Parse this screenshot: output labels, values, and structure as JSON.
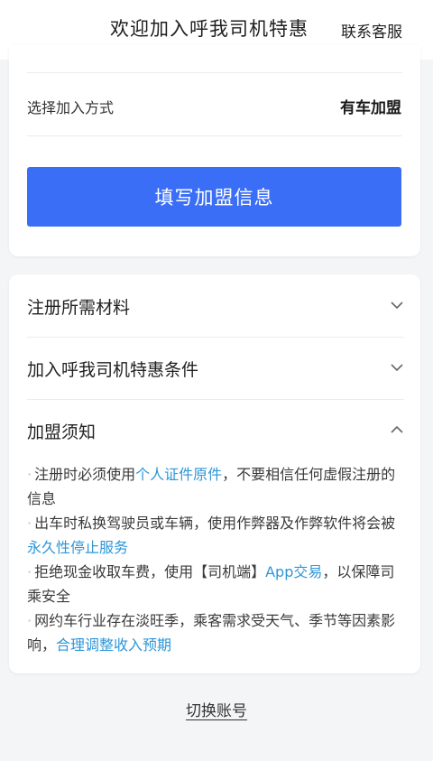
{
  "header": {
    "title": "欢迎加入呼我司机特惠",
    "service_label": "联系客服"
  },
  "join": {
    "method_label": "选择加入方式",
    "method_value": "有车加盟",
    "fill_button": "填写加盟信息"
  },
  "accordion": {
    "items": [
      {
        "label": "注册所需材料",
        "expanded": false,
        "icon": "chevron-down-icon"
      },
      {
        "label": "加入呼我司机特惠条件",
        "expanded": false,
        "icon": "chevron-down-icon"
      },
      {
        "label": "加盟须知",
        "expanded": true,
        "icon": "chevron-up-icon"
      }
    ],
    "notes": [
      {
        "bullet": "·",
        "pre": "注册时必须使用",
        "highlight": "个人证件原件",
        "post": "，不要相信任何虚假注册的信息"
      },
      {
        "bullet": "·",
        "pre": "出车时私换驾驶员或车辆，使用作弊器及作弊软件将会被",
        "highlight": "永久性停止服务",
        "post": ""
      },
      {
        "bullet": "·",
        "pre": "拒绝现金收取车费，使用【司机端】",
        "highlight": "App交易",
        "post": "，以保障司乘安全"
      },
      {
        "bullet": "·",
        "pre": "网约车行业存在淡旺季，乘客需求受天气、季节等因素影响，",
        "highlight": "合理调整收入预期",
        "post": ""
      }
    ]
  },
  "footer": {
    "switch_account": "切换账号"
  },
  "colors": {
    "primary_button": "#3a6ef6",
    "highlight_text": "#2e96d8",
    "background": "#f4f5f7"
  }
}
